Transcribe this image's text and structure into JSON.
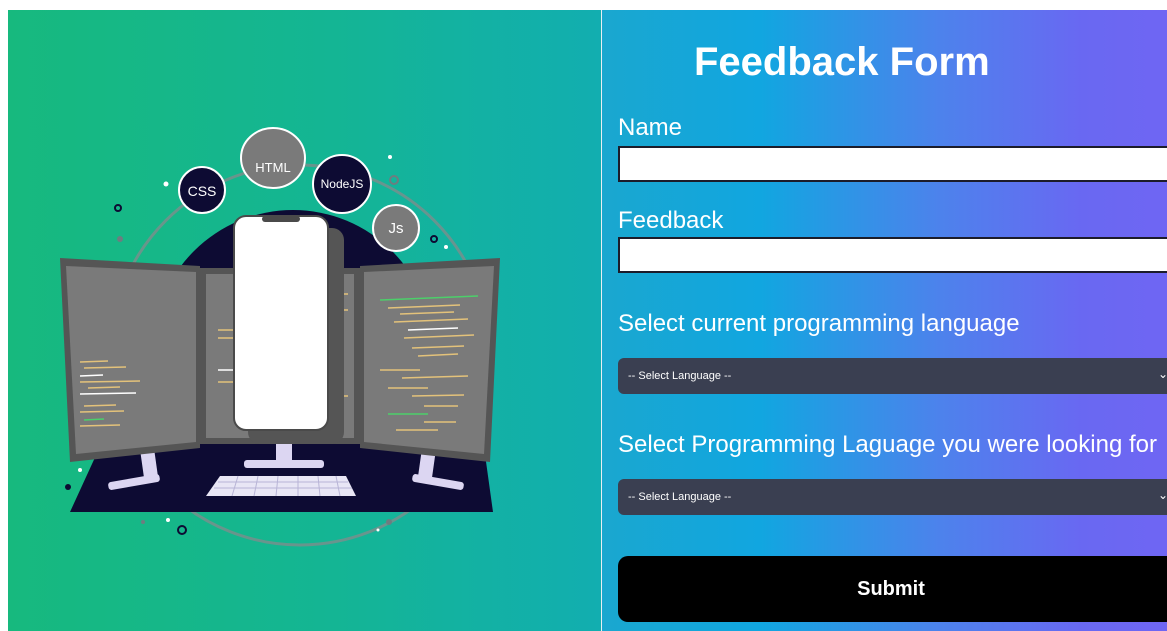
{
  "illustration": {
    "badges": [
      "CSS",
      "HTML",
      "NodeJS",
      "Js"
    ]
  },
  "form": {
    "title": "Feedback Form",
    "name_label": "Name",
    "name_value": "",
    "feedback_label": "Feedback",
    "feedback_value": "",
    "current_language_label": "Select current programming language",
    "current_language_selected": "-- Select Language --",
    "target_language_label": "Select Programming Laguage you were looking for",
    "target_language_selected": "-- Select Language --",
    "submit_label": "Submit"
  },
  "colors": {
    "left_gradient_start": "#17b97e",
    "left_gradient_end": "#12aeb0",
    "right_gradient_start": "#11a6e0",
    "right_gradient_end": "#6f66f3",
    "select_bg": "#3a3f51",
    "button_bg": "#000000",
    "dark_navy": "#0d0b33"
  }
}
